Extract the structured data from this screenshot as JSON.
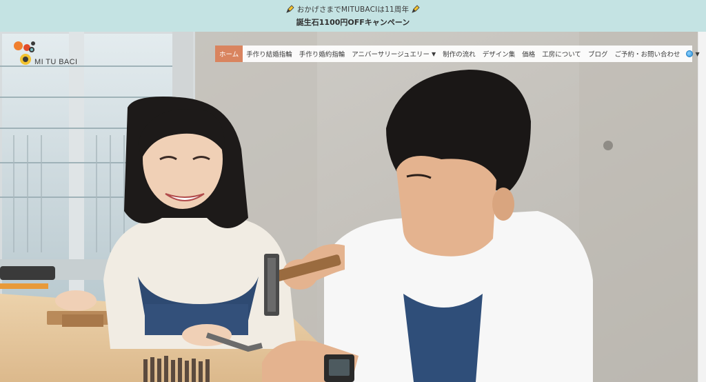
{
  "announcement": {
    "line1": "おかげさまでMITUBACIは11周年",
    "line2": "誕生石1100円OFFキャンペーン",
    "pencil_icon": "pencil-icon"
  },
  "logo": {
    "brand": "MI TU BACI",
    "colors": [
      "#f07f2e",
      "#e24b2a",
      "#7cc4c8",
      "#f2c230",
      "#3a3a3a"
    ]
  },
  "nav": {
    "items": [
      {
        "label": "ホーム",
        "active": true
      },
      {
        "label": "手作り結婚指輪"
      },
      {
        "label": "手作り婚約指輪"
      },
      {
        "label": "アニバーサリージュエリー",
        "dropdown": true
      },
      {
        "label": "制作の流れ"
      },
      {
        "label": "デザイン集"
      },
      {
        "label": "価格"
      },
      {
        "label": "工房について"
      },
      {
        "label": "ブログ"
      },
      {
        "label": "ご予約・お問い合わせ"
      }
    ],
    "language_icon": "globe-icon",
    "accent": "#d9845f"
  },
  "colors": {
    "announce_bg": "#c4e3e3",
    "wall": "#c9c6c0",
    "table": "#e7caa1"
  }
}
